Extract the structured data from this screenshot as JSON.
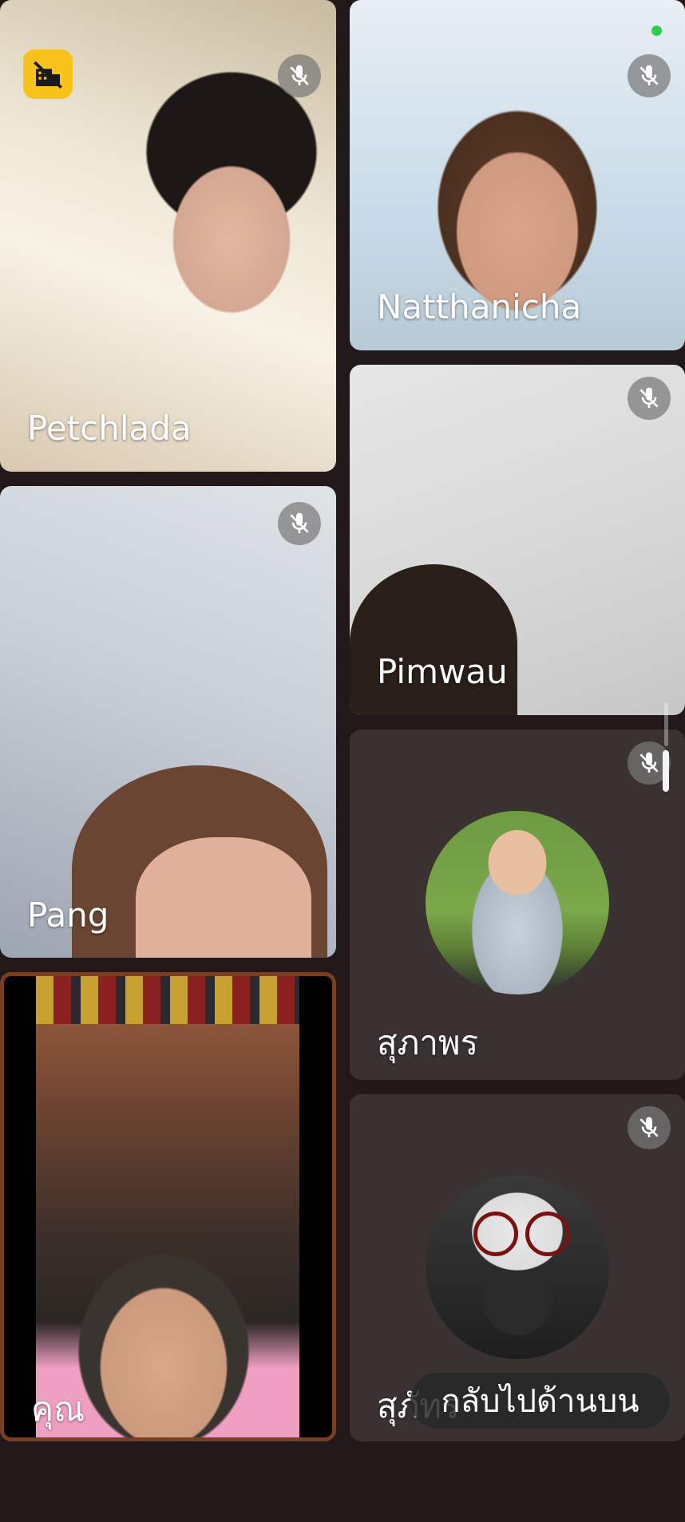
{
  "colors": {
    "background": "#201819",
    "tile_dark": "#3a3131",
    "badge": "#f6c21b",
    "self_border": "#7a3f22",
    "status_dot": "#2ecc52"
  },
  "participants": [
    {
      "id": "petchlada",
      "name": "Petchlada",
      "muted": true
    },
    {
      "id": "natthanicha",
      "name": "Natthanicha",
      "muted": true
    },
    {
      "id": "pimwau",
      "name": "Pimwau",
      "muted": true
    },
    {
      "id": "pang",
      "name": "Pang",
      "muted": true
    },
    {
      "id": "suparpon",
      "name": "สุภาพร",
      "muted": true
    },
    {
      "id": "supat",
      "name": "สุภัทร",
      "muted": true
    },
    {
      "id": "you",
      "name": "คุณ",
      "muted": false
    }
  ],
  "icons": {
    "mic_muted": "mic-off-icon",
    "badge": "no-signal-building-icon"
  },
  "scroll_to_top_label": "กลับไปด้านบน"
}
